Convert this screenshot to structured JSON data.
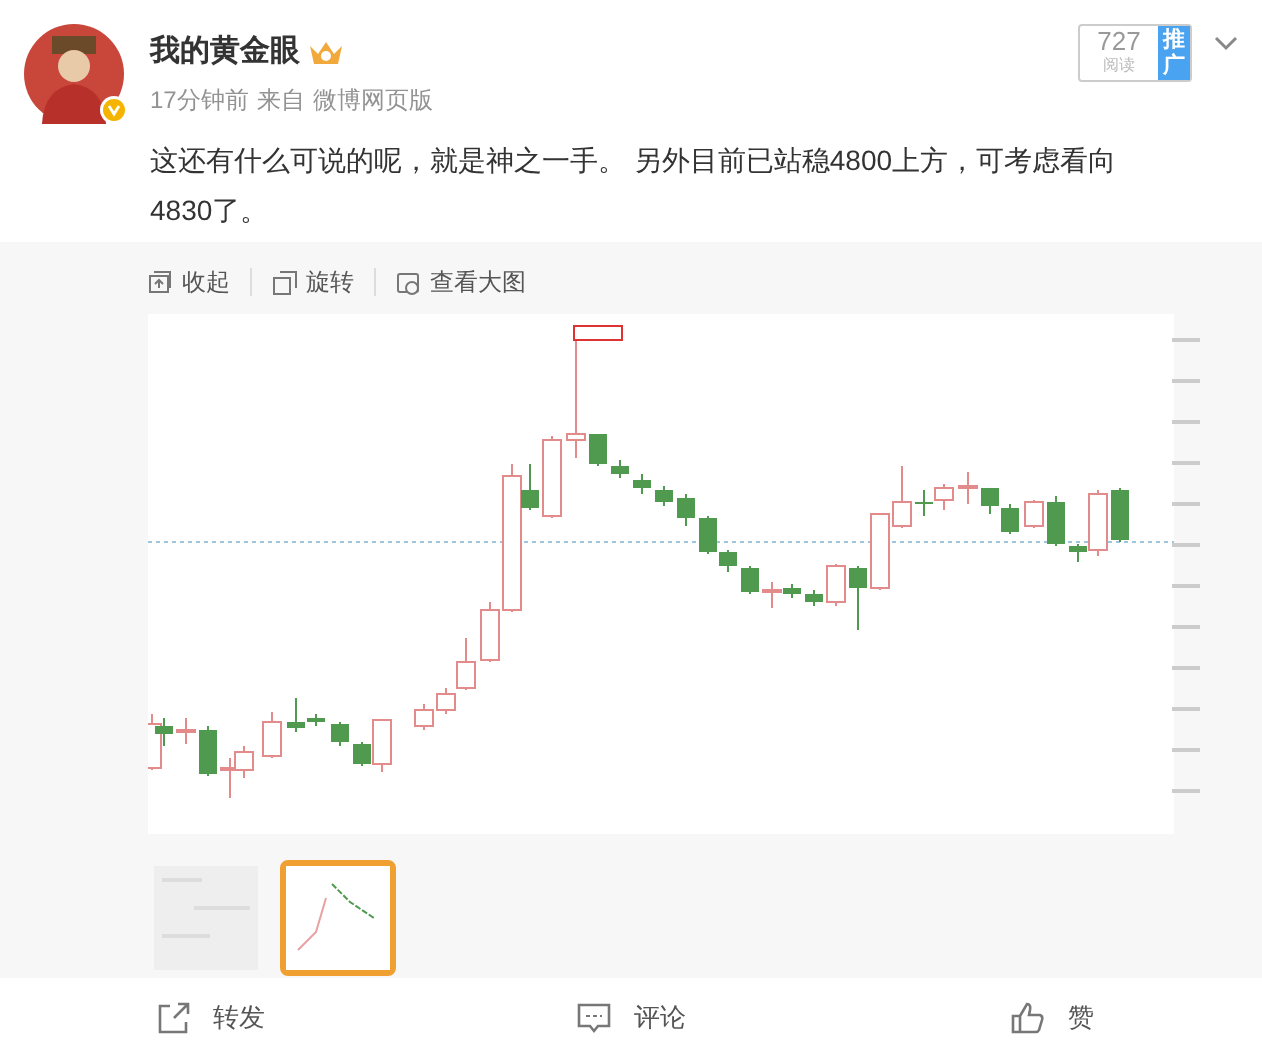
{
  "author": {
    "name": "我的黄金眼",
    "time": "17分钟前",
    "source_prefix": "来自",
    "source": "微博网页版"
  },
  "read_count": {
    "count": "727",
    "label": "阅读",
    "promote": "推广"
  },
  "text": "这还有什么可说的呢，就是神之一手。 另外目前已站稳4800上方，可考虑看向4830了。",
  "image_toolbar": [
    "收起",
    "旋转",
    "查看大图"
  ],
  "thumbnails": [
    {
      "selected": false
    },
    {
      "selected": true
    }
  ],
  "actions": [
    "转发",
    "评论",
    "赞"
  ]
}
